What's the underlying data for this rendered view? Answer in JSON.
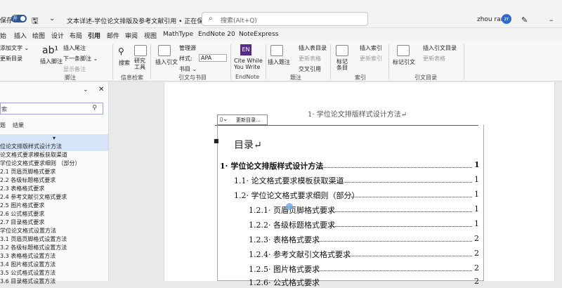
{
  "titlebar": {
    "autosave": "保存",
    "toggle": "开",
    "doc_title": "文本详述-学位论文排版及参考文献引用 • 正在保存... ⌄",
    "search_placeholder": "搜索(Alt+Q)",
    "user": "zhou ran"
  },
  "tabs": [
    "始",
    "插入",
    "绘图",
    "设计",
    "布局",
    "引用",
    "邮件",
    "审阅",
    "视图",
    "MathType",
    "EndNote 20",
    "NoteExpress"
  ],
  "comment_label": "批注",
  "ribbon": {
    "add_text": "添加文字 ⌄",
    "update_toc": "更新目录",
    "insert_footnote": "插入脚注",
    "insert_endnote": "插入尾注",
    "next_footnote": "下一条脚注 ⌄",
    "show_notes": "显示备注",
    "search": "搜索",
    "researcher": "研究\n工具",
    "insert_citation": "插入引文",
    "manage_sources": "管理源",
    "style_label": "样式:",
    "style_value": "APA",
    "bibliography": "书目 ⌄",
    "cite_while": "Cite While\nYou Write",
    "insert_caption": "插入题注",
    "insert_table_of_figures": "插入表目录",
    "update_table": "更新表格",
    "cross_reference": "交叉引用",
    "mark_entry": "标记\n条目",
    "insert_index": "插入索引",
    "update_index": "更新索引",
    "mark_citation": "标记引文",
    "insert_toa": "插入引文目录",
    "update_toa": "更新表格",
    "groups": [
      "脚注",
      "信息检索",
      "引文与书目",
      "EndNote",
      "题注",
      "索引",
      "引文目录"
    ]
  },
  "nav": {
    "search_placeholder": "索",
    "tab_headings": "题",
    "tab_results": "结果",
    "items": [
      "",
      "位论文排版样式设计方法",
      "论文格式要求模板获取渠道",
      "学位论文格式要求细则 （部分）",
      "2.1 页眉页脚格式要求",
      "2.2 各级标题格式要求",
      "2.3 表格格式要求",
      "2.4 参考文献引文格式要求",
      "2.5 图片格式要求",
      "2.6 公式格式要求",
      "2.7 目录格式要求",
      "学位论文格式设置方法",
      "3.1 页眉页脚格式设置方法",
      "3.2 各级标题格式设置方法",
      "3.3 表格格式设置方法",
      "3.4 图片格式设置方法",
      "3.5 公式格式设置方法",
      "3.6 目录格式设置方法"
    ]
  },
  "document": {
    "header": "1· 学位论文排版样式设计方法↵",
    "toc_toolbar": "更新目录...",
    "toc_title": "目录↵",
    "toc": [
      {
        "text": "1· 学位论文排版样式设计方法",
        "page": "1"
      },
      {
        "text": "1.1· 论文格式要求模板获取渠道",
        "page": "1"
      },
      {
        "text": "1.2· 学位论文格式要求细则（部分）",
        "page": "1"
      },
      {
        "text": "1.2.1· 页眉页脚格式要求",
        "page": "1"
      },
      {
        "text": "1.2.2· 各级标题格式要求",
        "page": "1"
      },
      {
        "text": "1.2.3· 表格格式要求",
        "page": "2"
      },
      {
        "text": "1.2.4· 参考文献引文格式要求",
        "page": "2"
      },
      {
        "text": "1.2.5· 图片格式要求",
        "page": "2"
      },
      {
        "text": "1.2.6· 公式格式要求",
        "page": "2"
      }
    ]
  }
}
